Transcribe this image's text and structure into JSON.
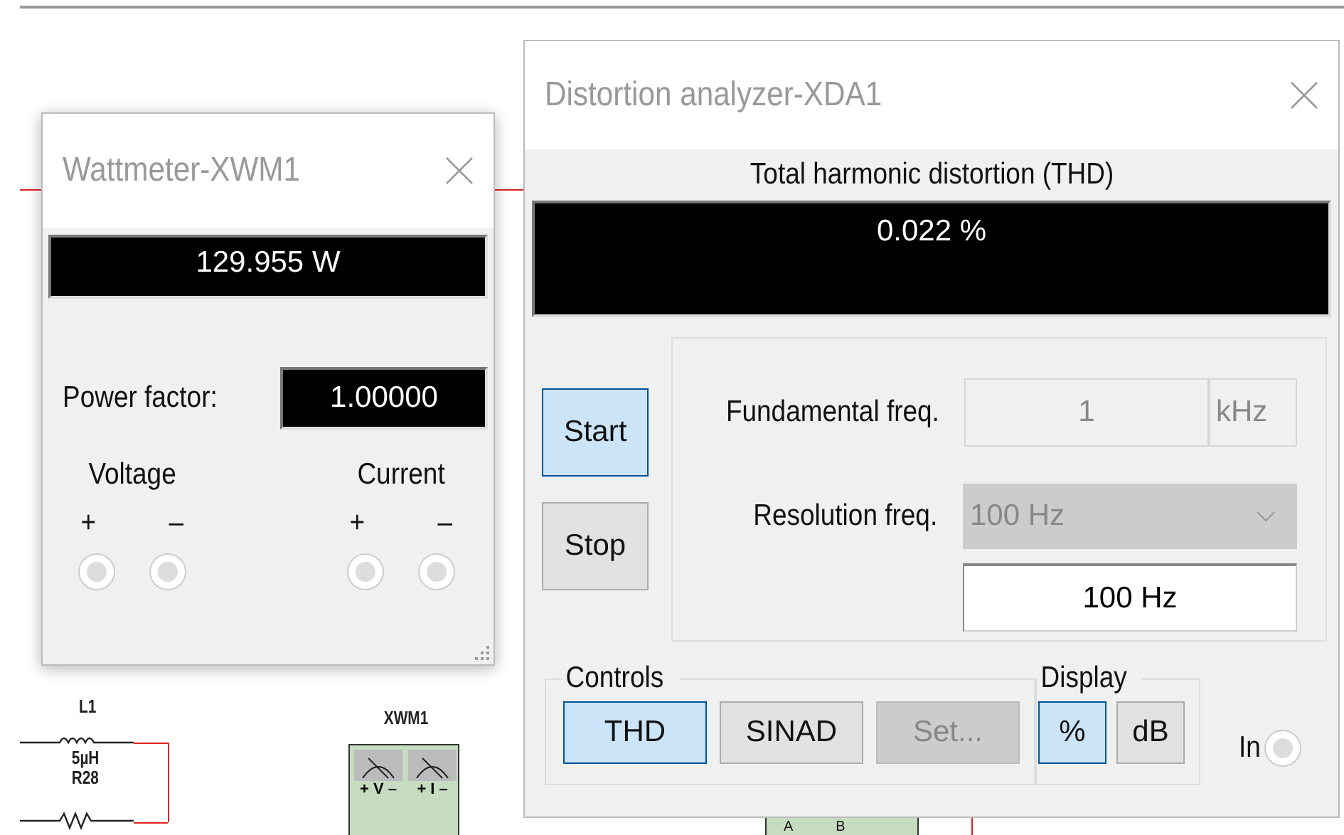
{
  "schematic": {
    "inductor_label": "L1",
    "inductor_value": "5µH",
    "resistor_label": "R28",
    "meter_label": "XWM1",
    "meter_terminals": [
      {
        "plus": "+",
        "name": "V",
        "minus": "–"
      },
      {
        "plus": "+",
        "name": "I",
        "minus": "–"
      }
    ],
    "block_pins": [
      "A",
      "B"
    ]
  },
  "wattmeter": {
    "title": "Wattmeter-XWM1",
    "display": "129.955 W",
    "power_factor_label": "Power factor:",
    "power_factor": "1.00000",
    "groups": [
      {
        "label": "Voltage",
        "plus": "+",
        "minus": "–"
      },
      {
        "label": "Current",
        "plus": "+",
        "minus": "–"
      }
    ]
  },
  "analyzer": {
    "title": "Distortion analyzer-XDA1",
    "heading": "Total harmonic distortion (THD)",
    "display": "0.022 %",
    "run_buttons": [
      {
        "label": "Start",
        "selected": true
      },
      {
        "label": "Stop",
        "selected": false
      }
    ],
    "fundamental_label": "Fundamental freq.",
    "fundamental_value": "1",
    "fundamental_unit": "kHz",
    "fundamental_disabled": true,
    "resolution_label": "Resolution freq.",
    "resolution_dropdown": "100 Hz",
    "resolution_disabled": true,
    "resolution_value": "100 Hz",
    "controls_label": "Controls",
    "controls": [
      {
        "label": "THD",
        "selected": true,
        "disabled": false
      },
      {
        "label": "SINAD",
        "selected": false,
        "disabled": false
      },
      {
        "label": "Set...",
        "selected": false,
        "disabled": true
      }
    ],
    "display_label": "Display",
    "display_modes": [
      {
        "label": "%",
        "selected": true
      },
      {
        "label": "dB",
        "selected": false
      }
    ],
    "terminal_label": "In"
  }
}
